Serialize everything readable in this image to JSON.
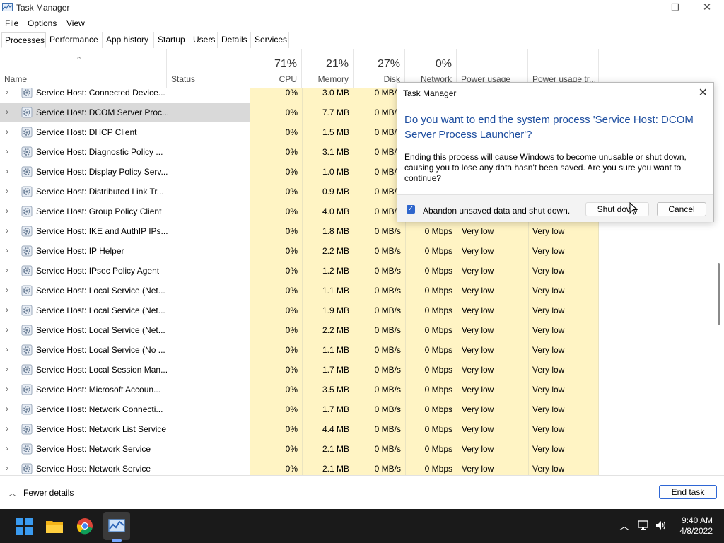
{
  "window": {
    "title": "Task Manager",
    "min_glyph": "—",
    "max_glyph": "❐",
    "close_glyph": "✕"
  },
  "menu": [
    "File",
    "Options",
    "View"
  ],
  "tabs": [
    "Processes",
    "Performance",
    "App history",
    "Startup",
    "Users",
    "Details",
    "Services"
  ],
  "columns": {
    "name": "Name",
    "status": "Status",
    "cpu": {
      "pct": "71%",
      "label": "CPU"
    },
    "memory": {
      "pct": "21%",
      "label": "Memory"
    },
    "disk": {
      "pct": "27%",
      "label": "Disk"
    },
    "network": {
      "pct": "0%",
      "label": "Network"
    },
    "power": "Power usage",
    "power_trend": "Power usage tr..."
  },
  "processes": [
    {
      "name": "Service Host: Connected Device...",
      "cpu": "0%",
      "mem": "3.0 MB",
      "disk": "0 MB/s",
      "net": "",
      "power": "",
      "trend": ""
    },
    {
      "name": "Service Host: DCOM Server Proc...",
      "cpu": "0%",
      "mem": "7.7 MB",
      "disk": "0 MB/s",
      "net": "",
      "power": "",
      "trend": ""
    },
    {
      "name": "Service Host: DHCP Client",
      "cpu": "0%",
      "mem": "1.5 MB",
      "disk": "0 MB/s",
      "net": "",
      "power": "",
      "trend": ""
    },
    {
      "name": "Service Host: Diagnostic Policy ...",
      "cpu": "0%",
      "mem": "3.1 MB",
      "disk": "0 MB/s",
      "net": "",
      "power": "",
      "trend": ""
    },
    {
      "name": "Service Host: Display Policy Serv...",
      "cpu": "0%",
      "mem": "1.0 MB",
      "disk": "0 MB/s",
      "net": "",
      "power": "",
      "trend": ""
    },
    {
      "name": "Service Host: Distributed Link Tr...",
      "cpu": "0%",
      "mem": "0.9 MB",
      "disk": "0 MB/s",
      "net": "",
      "power": "",
      "trend": ""
    },
    {
      "name": "Service Host: Group Policy Client",
      "cpu": "0%",
      "mem": "4.0 MB",
      "disk": "0 MB/s",
      "net": "",
      "power": "",
      "trend": ""
    },
    {
      "name": "Service Host: IKE and AuthIP IPs...",
      "cpu": "0%",
      "mem": "1.8 MB",
      "disk": "0 MB/s",
      "net": "0 Mbps",
      "power": "Very low",
      "trend": "Very low"
    },
    {
      "name": "Service Host: IP Helper",
      "cpu": "0%",
      "mem": "2.2 MB",
      "disk": "0 MB/s",
      "net": "0 Mbps",
      "power": "Very low",
      "trend": "Very low"
    },
    {
      "name": "Service Host: IPsec Policy Agent",
      "cpu": "0%",
      "mem": "1.2 MB",
      "disk": "0 MB/s",
      "net": "0 Mbps",
      "power": "Very low",
      "trend": "Very low"
    },
    {
      "name": "Service Host: Local Service (Net...",
      "cpu": "0%",
      "mem": "1.1 MB",
      "disk": "0 MB/s",
      "net": "0 Mbps",
      "power": "Very low",
      "trend": "Very low"
    },
    {
      "name": "Service Host: Local Service (Net...",
      "cpu": "0%",
      "mem": "1.9 MB",
      "disk": "0 MB/s",
      "net": "0 Mbps",
      "power": "Very low",
      "trend": "Very low"
    },
    {
      "name": "Service Host: Local Service (Net...",
      "cpu": "0%",
      "mem": "2.2 MB",
      "disk": "0 MB/s",
      "net": "0 Mbps",
      "power": "Very low",
      "trend": "Very low"
    },
    {
      "name": "Service Host: Local Service (No ...",
      "cpu": "0%",
      "mem": "1.1 MB",
      "disk": "0 MB/s",
      "net": "0 Mbps",
      "power": "Very low",
      "trend": "Very low"
    },
    {
      "name": "Service Host: Local Session Man...",
      "cpu": "0%",
      "mem": "1.7 MB",
      "disk": "0 MB/s",
      "net": "0 Mbps",
      "power": "Very low",
      "trend": "Very low"
    },
    {
      "name": "Service Host: Microsoft Accoun...",
      "cpu": "0%",
      "mem": "3.5 MB",
      "disk": "0 MB/s",
      "net": "0 Mbps",
      "power": "Very low",
      "trend": "Very low"
    },
    {
      "name": "Service Host: Network Connecti...",
      "cpu": "0%",
      "mem": "1.7 MB",
      "disk": "0 MB/s",
      "net": "0 Mbps",
      "power": "Very low",
      "trend": "Very low"
    },
    {
      "name": "Service Host: Network List Service",
      "cpu": "0%",
      "mem": "4.4 MB",
      "disk": "0 MB/s",
      "net": "0 Mbps",
      "power": "Very low",
      "trend": "Very low"
    },
    {
      "name": "Service Host: Network Service",
      "cpu": "0%",
      "mem": "2.1 MB",
      "disk": "0 MB/s",
      "net": "0 Mbps",
      "power": "Very low",
      "trend": "Very low"
    },
    {
      "name": "Service Host: Network Service",
      "cpu": "0%",
      "mem": "2.1 MB",
      "disk": "0 MB/s",
      "net": "0 Mbps",
      "power": "Very low",
      "trend": "Very low"
    }
  ],
  "selected_row": 1,
  "footer": {
    "fewer_details": "Fewer details",
    "end_task": "End task"
  },
  "dialog": {
    "title": "Task Manager",
    "heading": "Do you want to end the system process 'Service Host: DCOM Server Process Launcher'?",
    "body": "Ending this process will cause Windows to become unusable or shut down, causing you to lose any data hasn't been saved. Are you sure you want to continue?",
    "checkbox_label": "Abandon unsaved data and shut down.",
    "checkbox_checked": true,
    "shut_down": "Shut down",
    "cancel": "Cancel"
  },
  "taskbar": {
    "time": "9:40 AM",
    "date": "4/8/2022",
    "pinned": [
      "windows-start-icon",
      "file-explorer-icon",
      "chrome-icon",
      "task-manager-icon"
    ]
  },
  "colors": {
    "accent": "#2f66cc",
    "heat_light": "#fff4c4",
    "selected_row": "#d9d9d9",
    "dialog_heading": "#1f4fa0"
  }
}
